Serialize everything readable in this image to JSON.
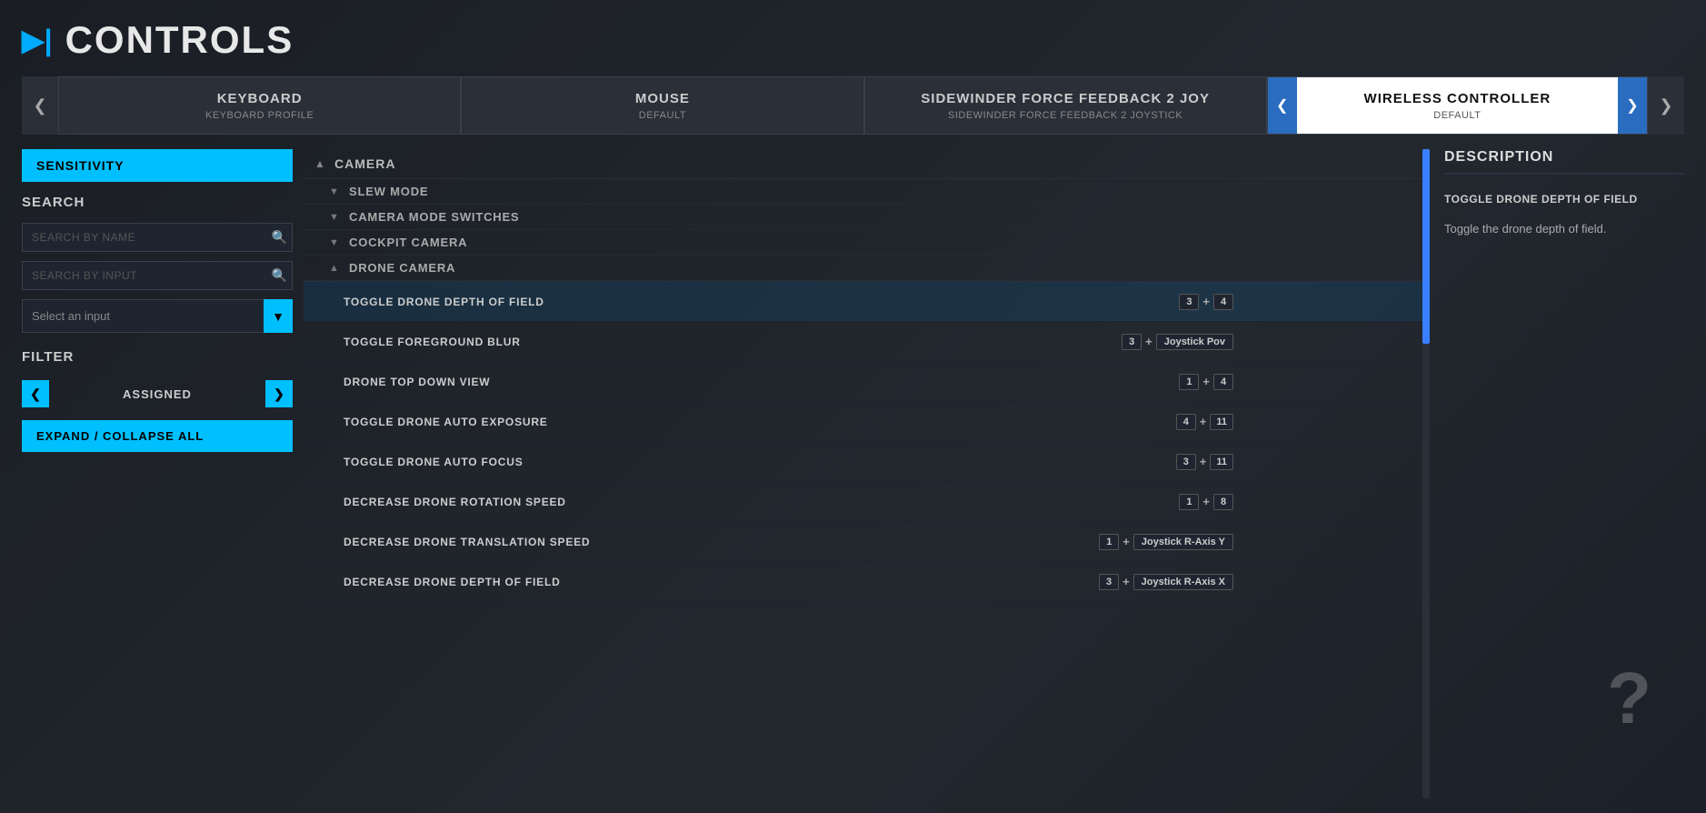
{
  "page": {
    "title": "CONTROLS",
    "icon": "▶|"
  },
  "tabs": [
    {
      "id": "keyboard",
      "label": "KEYBOARD",
      "sublabel": "KEYBOARD PROFILE",
      "active": false
    },
    {
      "id": "mouse",
      "label": "MOUSE",
      "sublabel": "DEFAULT",
      "active": false
    },
    {
      "id": "sidewinder",
      "label": "SIDEWINDER FORCE FEEDBACK 2 JOY",
      "sublabel": "SIDEWINDER FORCE FEEDBACK 2 JOYSTICK",
      "active": false
    }
  ],
  "wireless_tab": {
    "label": "WIRELESS CONTROLLER",
    "sublabel": "DEFAULT",
    "active": true
  },
  "sidebar": {
    "sensitivity_label": "SENSITIVITY",
    "search_label": "SEARCH",
    "search_by_name_placeholder": "SEARCH BY NAME",
    "search_by_input_placeholder": "SEARCH BY INPUT",
    "select_input_label": "Select an input",
    "filter_label": "FILTER",
    "filter_value": "ASSIGNED",
    "expand_collapse_label": "EXPAND / COLLAPSE ALL"
  },
  "description": {
    "title": "DESCRIPTION",
    "item_name": "TOGGLE DRONE DEPTH OF FIELD",
    "item_description": "Toggle the drone depth of field."
  },
  "controls": {
    "categories": [
      {
        "id": "camera",
        "name": "CAMERA",
        "expanded": true,
        "subcategories": [
          {
            "id": "slew_mode",
            "name": "SLEW MODE",
            "expanded": false,
            "items": []
          },
          {
            "id": "camera_mode_switches",
            "name": "CAMERA MODE SWITCHES",
            "expanded": false,
            "items": []
          },
          {
            "id": "cockpit_camera",
            "name": "COCKPIT CAMERA",
            "expanded": false,
            "items": []
          },
          {
            "id": "drone_camera",
            "name": "DRONE CAMERA",
            "expanded": true,
            "items": [
              {
                "id": "toggle_drone_dof",
                "name": "TOGGLE DRONE DEPTH OF FIELD",
                "binding_key1": "3",
                "binding_plus": "+",
                "binding_key2": "4",
                "selected": true
              },
              {
                "id": "toggle_foreground_blur",
                "name": "TOGGLE FOREGROUND BLUR",
                "binding_key1": "3",
                "binding_plus": "+",
                "binding_key2": "Joystick Pov",
                "key2_text": true
              },
              {
                "id": "drone_top_down_view",
                "name": "DRONE TOP DOWN VIEW",
                "binding_key1": "1",
                "binding_plus": "+",
                "binding_key2": "4"
              },
              {
                "id": "toggle_drone_auto_exposure",
                "name": "TOGGLE DRONE AUTO EXPOSURE",
                "binding_key1": "4",
                "binding_plus": "+",
                "binding_key2": "11"
              },
              {
                "id": "toggle_drone_auto_focus",
                "name": "TOGGLE DRONE AUTO FOCUS",
                "binding_key1": "3",
                "binding_plus": "+",
                "binding_key2": "11"
              },
              {
                "id": "decrease_drone_rotation_speed",
                "name": "DECREASE DRONE ROTATION SPEED",
                "binding_key1": "1",
                "binding_plus": "+",
                "binding_key2": "8"
              },
              {
                "id": "decrease_drone_translation_speed",
                "name": "DECREASE DRONE TRANSLATION SPEED",
                "binding_key1": "1",
                "binding_plus": "+",
                "binding_key2": "Joystick R-Axis Y",
                "key2_text": true
              },
              {
                "id": "decrease_drone_depth_of_field",
                "name": "DECREASE DRONE DEPTH OF FIELD",
                "binding_key1": "3",
                "binding_plus": "+",
                "binding_key2": "Joystick R-Axis X",
                "key2_text": true
              }
            ]
          }
        ]
      }
    ]
  },
  "help_icon": "?",
  "nav_prev": "❮",
  "nav_next": "❯",
  "chevron_up": "▲",
  "chevron_down": "▼",
  "chevron_right": "▶"
}
